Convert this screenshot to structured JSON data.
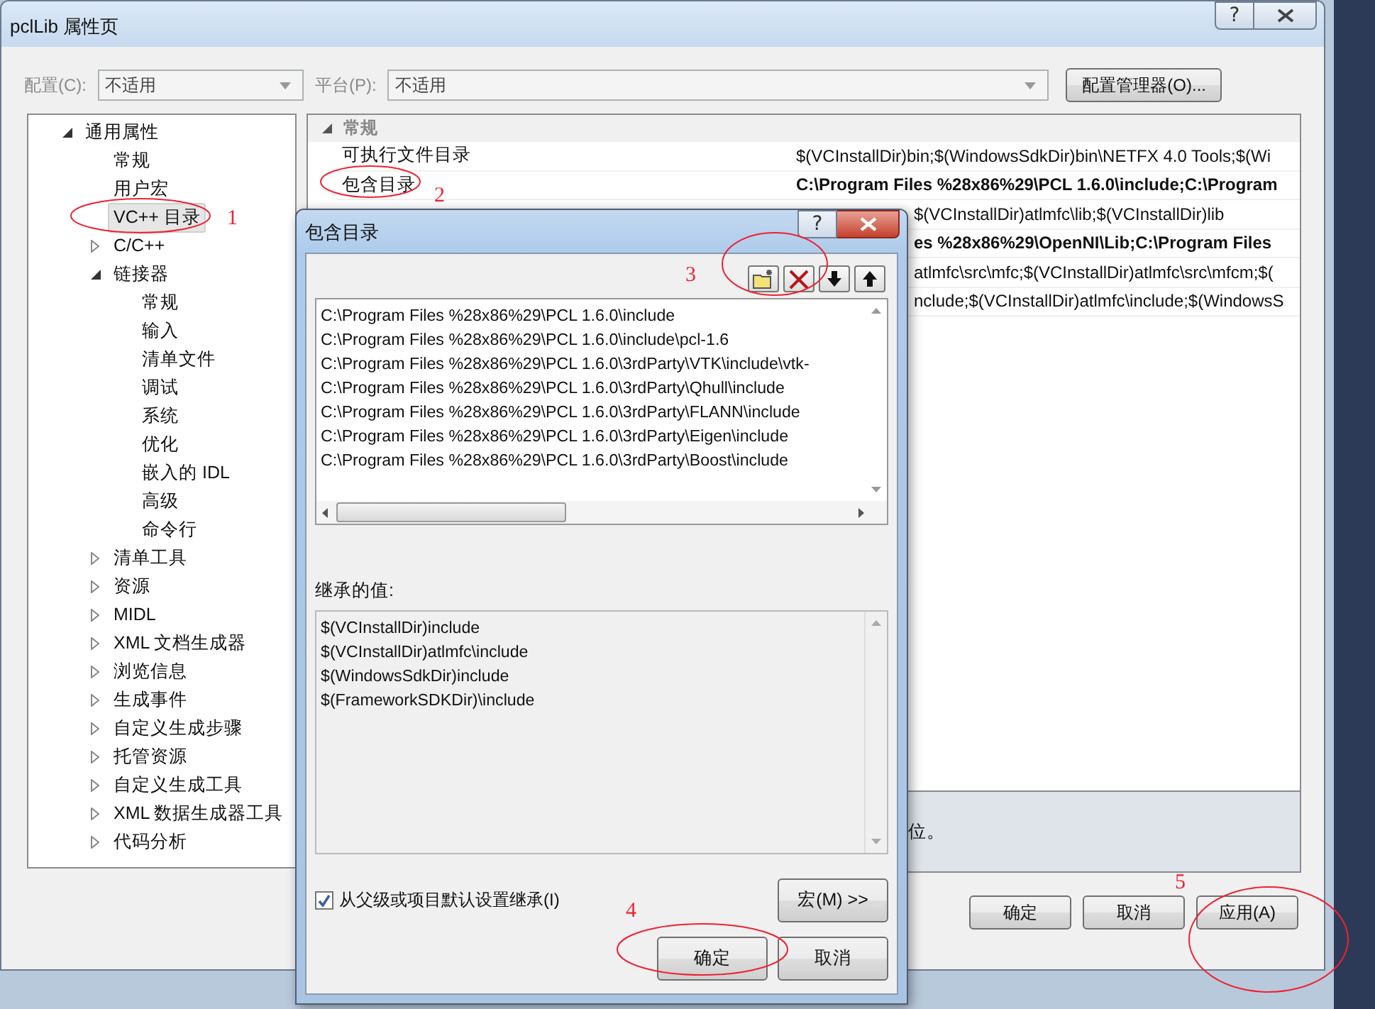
{
  "window": {
    "title": "pclLib 属性页",
    "help": "?"
  },
  "config": {
    "label": "配置(C):",
    "value": "不适用",
    "disabled": true
  },
  "platform": {
    "label": "平台(P):",
    "value": "不适用",
    "disabled": true
  },
  "config_manager_button": "配置管理器(O)...",
  "tree": [
    {
      "label": "通用属性",
      "selected": false,
      "expanded": true,
      "children": [
        {
          "label": "常规",
          "selected": false
        },
        {
          "label": "用户宏",
          "selected": false
        },
        {
          "label": "VC++ 目录",
          "selected": true
        },
        {
          "label": "C/C++",
          "selected": false,
          "expanded": false
        },
        {
          "label": "链接器",
          "selected": false,
          "expanded": true,
          "children": [
            {
              "label": "常规",
              "selected": false
            },
            {
              "label": "输入",
              "selected": false
            },
            {
              "label": "清单文件",
              "selected": false
            },
            {
              "label": "调试",
              "selected": false
            },
            {
              "label": "系统",
              "selected": false
            },
            {
              "label": "优化",
              "selected": false
            },
            {
              "label": "嵌入的 IDL",
              "selected": false
            },
            {
              "label": "高级",
              "selected": false
            },
            {
              "label": "命令行",
              "selected": false
            }
          ]
        },
        {
          "label": "清单工具",
          "selected": false,
          "expanded": false
        },
        {
          "label": "资源",
          "selected": false,
          "expanded": false
        },
        {
          "label": "MIDL",
          "selected": false,
          "expanded": false
        },
        {
          "label": "XML 文档生成器",
          "selected": false,
          "expanded": false
        },
        {
          "label": "浏览信息",
          "selected": false,
          "expanded": false
        },
        {
          "label": "生成事件",
          "selected": false,
          "expanded": false
        },
        {
          "label": "自定义生成步骤",
          "selected": false,
          "expanded": false
        },
        {
          "label": "托管资源",
          "selected": false,
          "expanded": false
        },
        {
          "label": "自定义生成工具",
          "selected": false,
          "expanded": false
        },
        {
          "label": "XML 数据生成器工具",
          "selected": false,
          "expanded": false
        },
        {
          "label": "代码分析",
          "selected": false,
          "expanded": false
        }
      ]
    }
  ],
  "grid": {
    "category": {
      "label": "常规",
      "expanded": true
    },
    "rows": [
      {
        "kind": "full",
        "label": "可执行文件目录",
        "value": "$(VCInstallDir)bin;$(WindowsSdkDir)bin\\NETFX 4.0 Tools;$(Wi",
        "bold": false
      },
      {
        "kind": "full",
        "label": "包含目录",
        "value": "C:\\Program Files %28x86%29\\PCL 1.6.0\\include;C:\\Program",
        "bold": true
      },
      {
        "kind": "partial",
        "value": "$(VCInstallDir)atlmfc\\lib;$(VCInstallDir)lib",
        "bold": false
      },
      {
        "kind": "partial",
        "value": "es %28x86%29\\OpenNI\\Lib;C:\\Program Files",
        "bold": true
      },
      {
        "kind": "partial",
        "value": "atlmfc\\src\\mfc;$(VCInstallDir)atlmfc\\src\\mfcm;$(",
        "bold": false
      },
      {
        "kind": "partial",
        "value": "nclude;$(VCInstallDir)atlmfc\\include;$(WindowsS",
        "bold": false
      }
    ]
  },
  "description": "位。",
  "buttons": [
    "确定",
    "取消",
    "应用(A)"
  ],
  "dialog": {
    "title": "包含目录",
    "help": "?",
    "paths": [
      "C:\\Program Files %28x86%29\\PCL 1.6.0\\include",
      "C:\\Program Files %28x86%29\\PCL 1.6.0\\include\\pcl-1.6",
      "C:\\Program Files %28x86%29\\PCL 1.6.0\\3rdParty\\VTK\\include\\vtk-",
      "C:\\Program Files %28x86%29\\PCL 1.6.0\\3rdParty\\Qhull\\include",
      "C:\\Program Files %28x86%29\\PCL 1.6.0\\3rdParty\\FLANN\\include",
      "C:\\Program Files %28x86%29\\PCL 1.6.0\\3rdParty\\Eigen\\include",
      "C:\\Program Files %28x86%29\\PCL 1.6.0\\3rdParty\\Boost\\include"
    ],
    "inherited_label": "继承的值:",
    "inherited": [
      "$(VCInstallDir)include",
      "$(VCInstallDir)atlmfc\\include",
      "$(WindowsSdkDir)include",
      "$(FrameworkSDKDir)\\include"
    ],
    "inherit_checkbox": {
      "label": "从父级或项目默认设置继承(I)",
      "checked": true
    },
    "macro_button": "宏(M) >>",
    "buttons": [
      "确定",
      "取消"
    ]
  },
  "annotations": [
    "1",
    "2",
    "3",
    "4",
    "5"
  ]
}
